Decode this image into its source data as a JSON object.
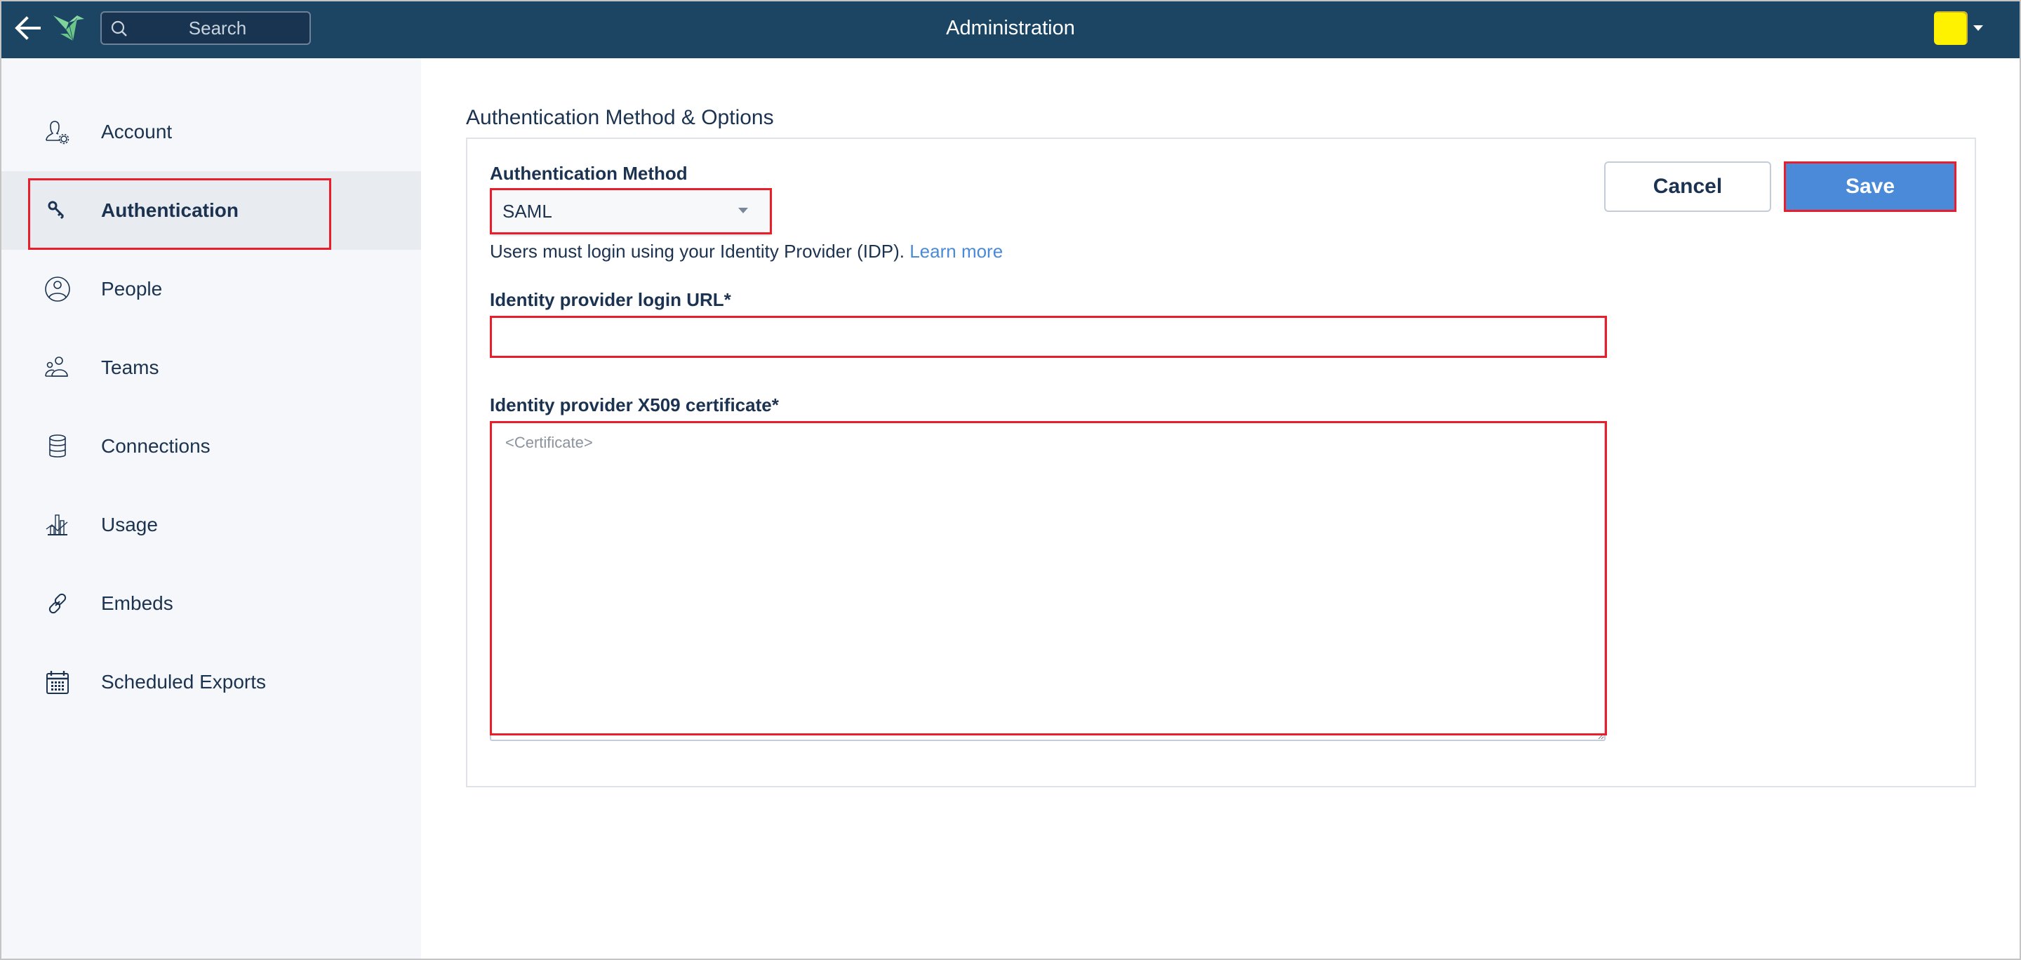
{
  "header": {
    "title": "Administration",
    "search": {
      "placeholder": "Search",
      "value": ""
    },
    "back_icon": "arrow-left-icon",
    "logo_icon": "origami-bird-logo",
    "avatar_color": "#fff200"
  },
  "sidebar": {
    "items": [
      {
        "label": "Account",
        "icon": "user-gear-icon",
        "active": false
      },
      {
        "label": "Authentication",
        "icon": "key-icon",
        "active": true
      },
      {
        "label": "People",
        "icon": "user-circle-icon",
        "active": false
      },
      {
        "label": "Teams",
        "icon": "users-icon",
        "active": false
      },
      {
        "label": "Connections",
        "icon": "database-icon",
        "active": false
      },
      {
        "label": "Usage",
        "icon": "bar-chart-icon",
        "active": false
      },
      {
        "label": "Embeds",
        "icon": "link-icon",
        "active": false
      },
      {
        "label": "Scheduled Exports",
        "icon": "calendar-icon",
        "active": false
      }
    ]
  },
  "main": {
    "section_title": "Authentication Method & Options",
    "auth_method": {
      "label": "Authentication Method",
      "selected": "SAML",
      "help_text": "Users must login using your Identity Provider (IDP). ",
      "learn_more": "Learn more"
    },
    "login_url": {
      "label": "Identity provider login URL*",
      "value": "",
      "placeholder": ""
    },
    "certificate": {
      "label": "Identity provider X509 certificate*",
      "value": "",
      "placeholder": "<Certificate>"
    },
    "buttons": {
      "cancel": "Cancel",
      "save": "Save"
    }
  },
  "colors": {
    "header_bg": "#1b4563",
    "accent": "#4a8ad8",
    "highlight": "#e81e2a",
    "sidebar_bg": "#f5f7fa",
    "sidebar_active_bg": "#e8ebf0"
  }
}
